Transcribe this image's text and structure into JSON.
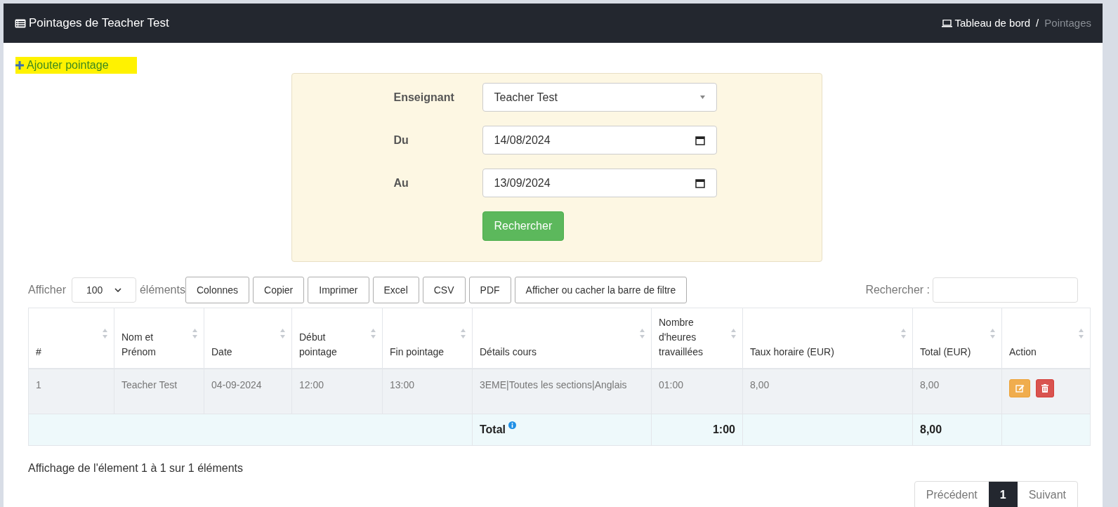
{
  "header": {
    "title": "Pointages de Teacher Test",
    "breadcrumb_separator": "/",
    "breadcrumb": [
      {
        "label": "Tableau de bord",
        "kind": "link"
      },
      {
        "label": "Pointages",
        "kind": "current"
      }
    ]
  },
  "add_link": {
    "label": "Ajouter pointage",
    "highlighted": true
  },
  "filters": {
    "fields": [
      {
        "label": "Enseignant",
        "kind": "select",
        "value": "Teacher Test"
      },
      {
        "label": "Du",
        "kind": "date",
        "value": "14/08/2024"
      },
      {
        "label": "Au",
        "kind": "date",
        "value": "13/09/2024"
      }
    ],
    "submit": "Rechercher"
  },
  "toolbar": {
    "show_label": "Afficher",
    "page_size": "100",
    "show_suffix": "éléments",
    "buttons": [
      "Colonnes",
      "Copier",
      "Imprimer",
      "Excel",
      "CSV",
      "PDF",
      "Afficher ou cacher la barre de filtre"
    ],
    "search_label": "Rechercher :"
  },
  "table": {
    "columns": [
      "#",
      "Nom et Prénom",
      "Date",
      "Début pointage",
      "Fin pointage",
      "Détails cours",
      "Nombre d'heures travaillées",
      "Taux horaire (EUR)",
      "Total (EUR)",
      "Action"
    ],
    "rows": [
      {
        "cells": [
          "1",
          "Teacher Test",
          "04-09-2024",
          "12:00",
          "13:00",
          "3EME|Toutes les sections|Anglais",
          "01:00",
          "8,00",
          "8,00"
        ]
      }
    ],
    "footer": {
      "label": "Total",
      "hours": "1:00",
      "total": "8,00"
    }
  },
  "info": "Affichage de l'élement 1 à 1 sur 1 éléments",
  "pagination": {
    "previous": "Précédent",
    "pages": [
      {
        "label": "1",
        "selected": true
      }
    ],
    "next": "Suivant"
  }
}
